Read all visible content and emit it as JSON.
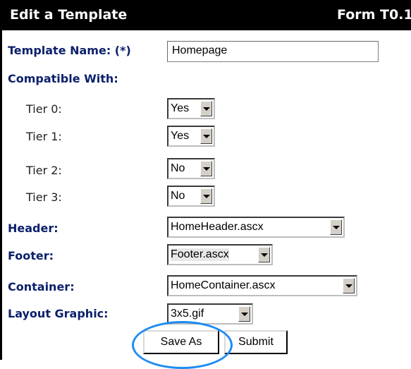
{
  "form": {
    "title": "Edit a Template",
    "form_id": "Form T0.1"
  },
  "fields": {
    "template_name": {
      "label": "Template Name: (*)",
      "value": "Homepage"
    },
    "compatible_with": {
      "label": "Compatible With:"
    },
    "tiers": [
      {
        "label": "Tier 0:",
        "value": "Yes"
      },
      {
        "label": "Tier 1:",
        "value": "Yes"
      },
      {
        "label": "Tier 2:",
        "value": "No"
      },
      {
        "label": "Tier 3:",
        "value": "No"
      }
    ],
    "header": {
      "label": "Header:",
      "value": "HomeHeader.ascx"
    },
    "footer": {
      "label": "Footer:",
      "value": "Footer.ascx"
    },
    "container": {
      "label": "Container:",
      "value": "HomeContainer.ascx"
    },
    "layout_graphic": {
      "label": "Layout Graphic:",
      "value": "3x5.gif"
    }
  },
  "buttons": {
    "save_as": "Save As",
    "submit": "Submit"
  },
  "annotation": {
    "ring_color": "#1e8cf2"
  }
}
